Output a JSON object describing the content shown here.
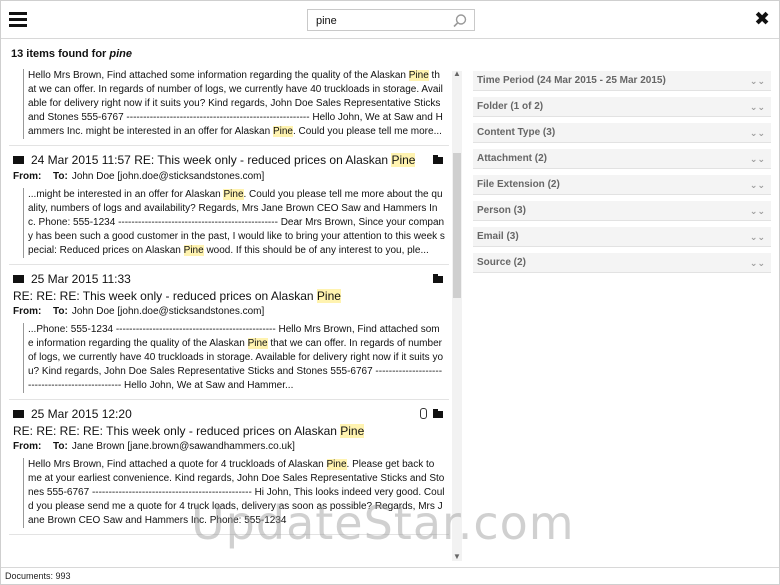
{
  "search": {
    "value": "pine"
  },
  "results_header": {
    "count_text": "13 items found for ",
    "query": "pine"
  },
  "results": [
    {
      "date": "",
      "subject_inline": "",
      "subject_line": "",
      "from": "",
      "to": "",
      "snippet": [
        [
          "Hello Mrs Brown, Find attached some information regarding the quality of the Alaskan ",
          false
        ],
        [
          "Pine",
          true
        ],
        [
          " that we can offer. In regards of number of logs, we currently have 40 truckloads in storage. Available for delivery right now if it suits you? Kind regards, John Doe Sales Representative Sticks and Stones 555-6767 ------------------------------------------------------- Hello John, We at Saw and Hammers Inc. might be interested in an offer for Alaskan ",
          false
        ],
        [
          "Pine",
          true
        ],
        [
          ". Could you please tell me more...",
          false
        ]
      ]
    },
    {
      "date": "24 Mar 2015 11:57",
      "subject_inline": "RE: This week only - reduced prices on Alaskan ",
      "subject_hl": "Pine",
      "subject_line": "",
      "from": "",
      "to": "John Doe [john.doe@sticksandstones.com]",
      "snippet": [
        [
          "...might be interested in an offer for Alaskan ",
          false
        ],
        [
          "Pine",
          true
        ],
        [
          ". Could you please tell me more about the quality, numbers of logs and availability? Regards, Mrs Jane Brown CEO Saw and Hammers Inc. Phone: 555-1234 ------------------------------------------------ Dear Mrs Brown, Since your company has been such a good customer in the past, I would like to bring your attention to this week special: Reduced prices on Alaskan ",
          false
        ],
        [
          "Pine",
          true
        ],
        [
          " wood. If this should be of any interest to you, ple...",
          false
        ]
      ]
    },
    {
      "date": "25 Mar 2015 11:33",
      "subject_inline": "",
      "subject_line": "RE: RE: RE: This week only - reduced prices on Alaskan ",
      "subject_hl": "Pine",
      "from": "",
      "to": "John Doe [john.doe@sticksandstones.com]",
      "snippet": [
        [
          "...Phone: 555-1234 ------------------------------------------------ Hello Mrs Brown, Find attached some information regarding the quality of the Alaskan ",
          false
        ],
        [
          "Pine",
          true
        ],
        [
          " that we can offer. In regards of number of logs, we currently have 40 truckloads in storage. Available for delivery right now if it suits you? Kind regards, John Doe Sales Representative Sticks and Stones 555-6767 ------------------------------------------------ Hello John, We at Saw and Hammer...",
          false
        ]
      ]
    },
    {
      "date": "25 Mar 2015 12:20",
      "subject_inline": "",
      "subject_line": "RE: RE: RE: RE: This week only - reduced prices on Alaskan ",
      "subject_hl": "Pine",
      "from": "",
      "to": "Jane Brown [jane.brown@sawandhammers.co.uk]",
      "snippet": [
        [
          "Hello Mrs Brown, Find attached a quote for 4 truckloads of Alaskan ",
          false
        ],
        [
          "Pine",
          true
        ],
        [
          ". Please get back to me at your earliest convenience. Kind regards, John Doe Sales Representative Sticks and Stones 555-6767 ------------------------------------------------ Hi John, This looks indeed very good. Could you please send me a quote for 4 truck loads, delivery as soon as possible? Regards, Mrs Jane Brown CEO Saw and Hammers Inc. Phone: 555-1234",
          false
        ]
      ]
    }
  ],
  "labels": {
    "from": "From:",
    "to": "To:"
  },
  "facets": [
    "Time Period (24 Mar 2015 - 25 Mar 2015)",
    "Folder (1 of 2)",
    "Content Type (3)",
    "Attachment (2)",
    "File Extension (2)",
    "Person (3)",
    "Email (3)",
    "Source (2)"
  ],
  "status": {
    "documents": "Documents: 993"
  },
  "watermark": "UpdateStar.com"
}
